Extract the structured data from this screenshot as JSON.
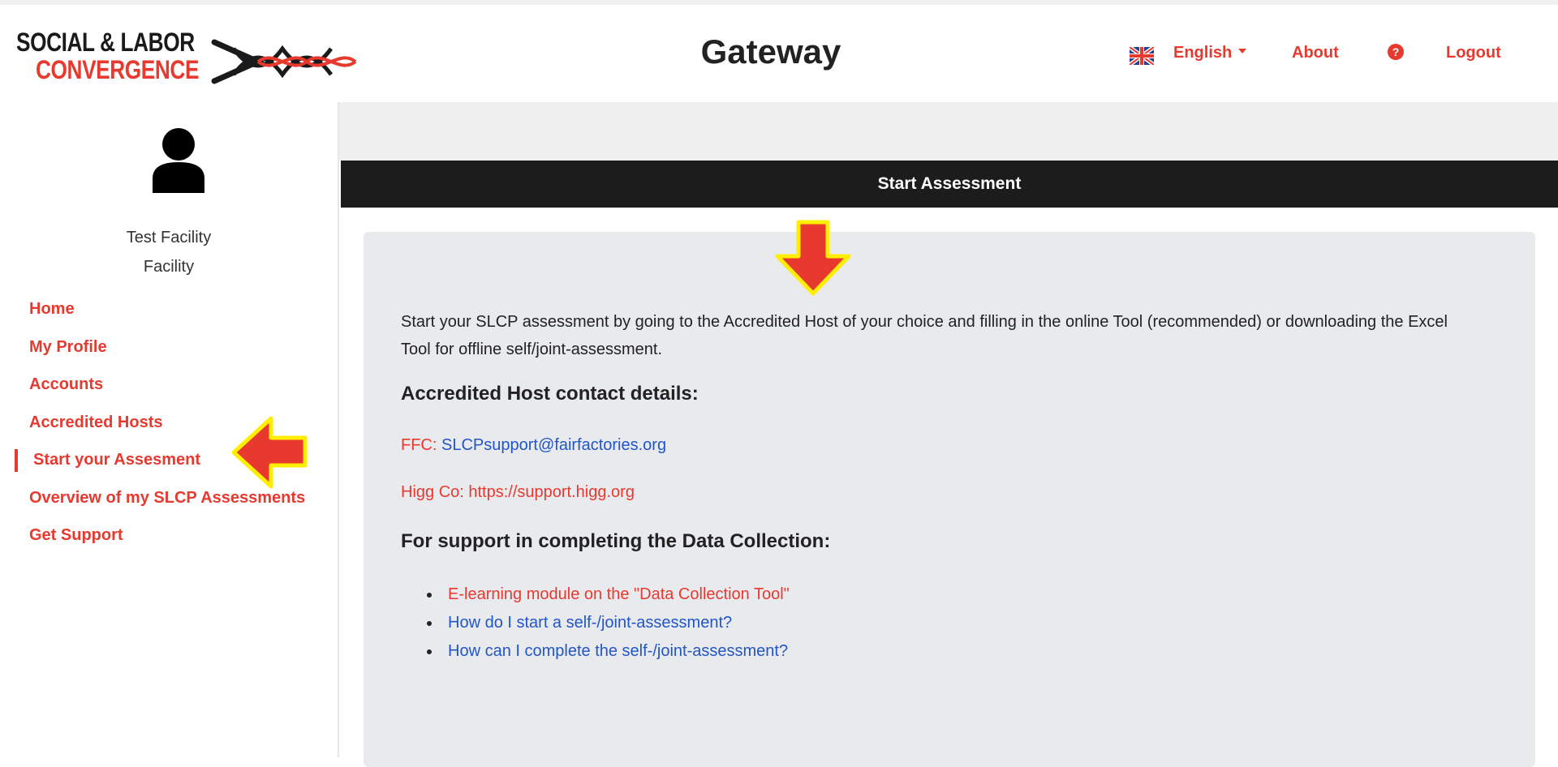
{
  "header": {
    "logo_line1": "SOCIAL & LABOR",
    "logo_line2": "CONVERGENCE",
    "app_title": "Gateway",
    "language": "English",
    "about": "About",
    "help_icon": "question-circle-icon",
    "logout": "Logout"
  },
  "sidebar": {
    "avatar_icon": "user-icon",
    "facility_name": "Test Facility",
    "facility_type": "Facility",
    "items": [
      {
        "label": "Home"
      },
      {
        "label": "My Profile"
      },
      {
        "label": "Accounts"
      },
      {
        "label": "Accredited Hosts"
      },
      {
        "label": "Start your Assesment",
        "active": true
      },
      {
        "label": "Overview of my SLCP Assessments"
      },
      {
        "label": "Get Support"
      }
    ]
  },
  "main": {
    "banner_title": "Start Assessment",
    "intro": "Start your SLCP assessment by going to the Accredited Host of your choice and filling in the online Tool (recommended) or downloading the Excel Tool for offline self/joint-assessment.",
    "contact_heading": "Accredited Host contact details:",
    "ffc_label": "FFC: ",
    "ffc_email": "SLCPsupport@fairfactories.org",
    "higg_label": "Higg Co: ",
    "higg_url": "https://support.higg.org",
    "support_heading": "For support in completing the Data Collection:",
    "links": [
      "E-learning module on the \"Data Collection Tool\"",
      "How do I start a self-/joint-assessment?",
      "How can I complete the self-/joint-assessment?"
    ]
  },
  "colors": {
    "accent": "#e8392f",
    "link_blue": "#2255c8",
    "banner": "#1c1c1c",
    "panel": "#e8eaed",
    "annotation_arrow": "#e8392f",
    "annotation_outline": "#ffee00"
  }
}
